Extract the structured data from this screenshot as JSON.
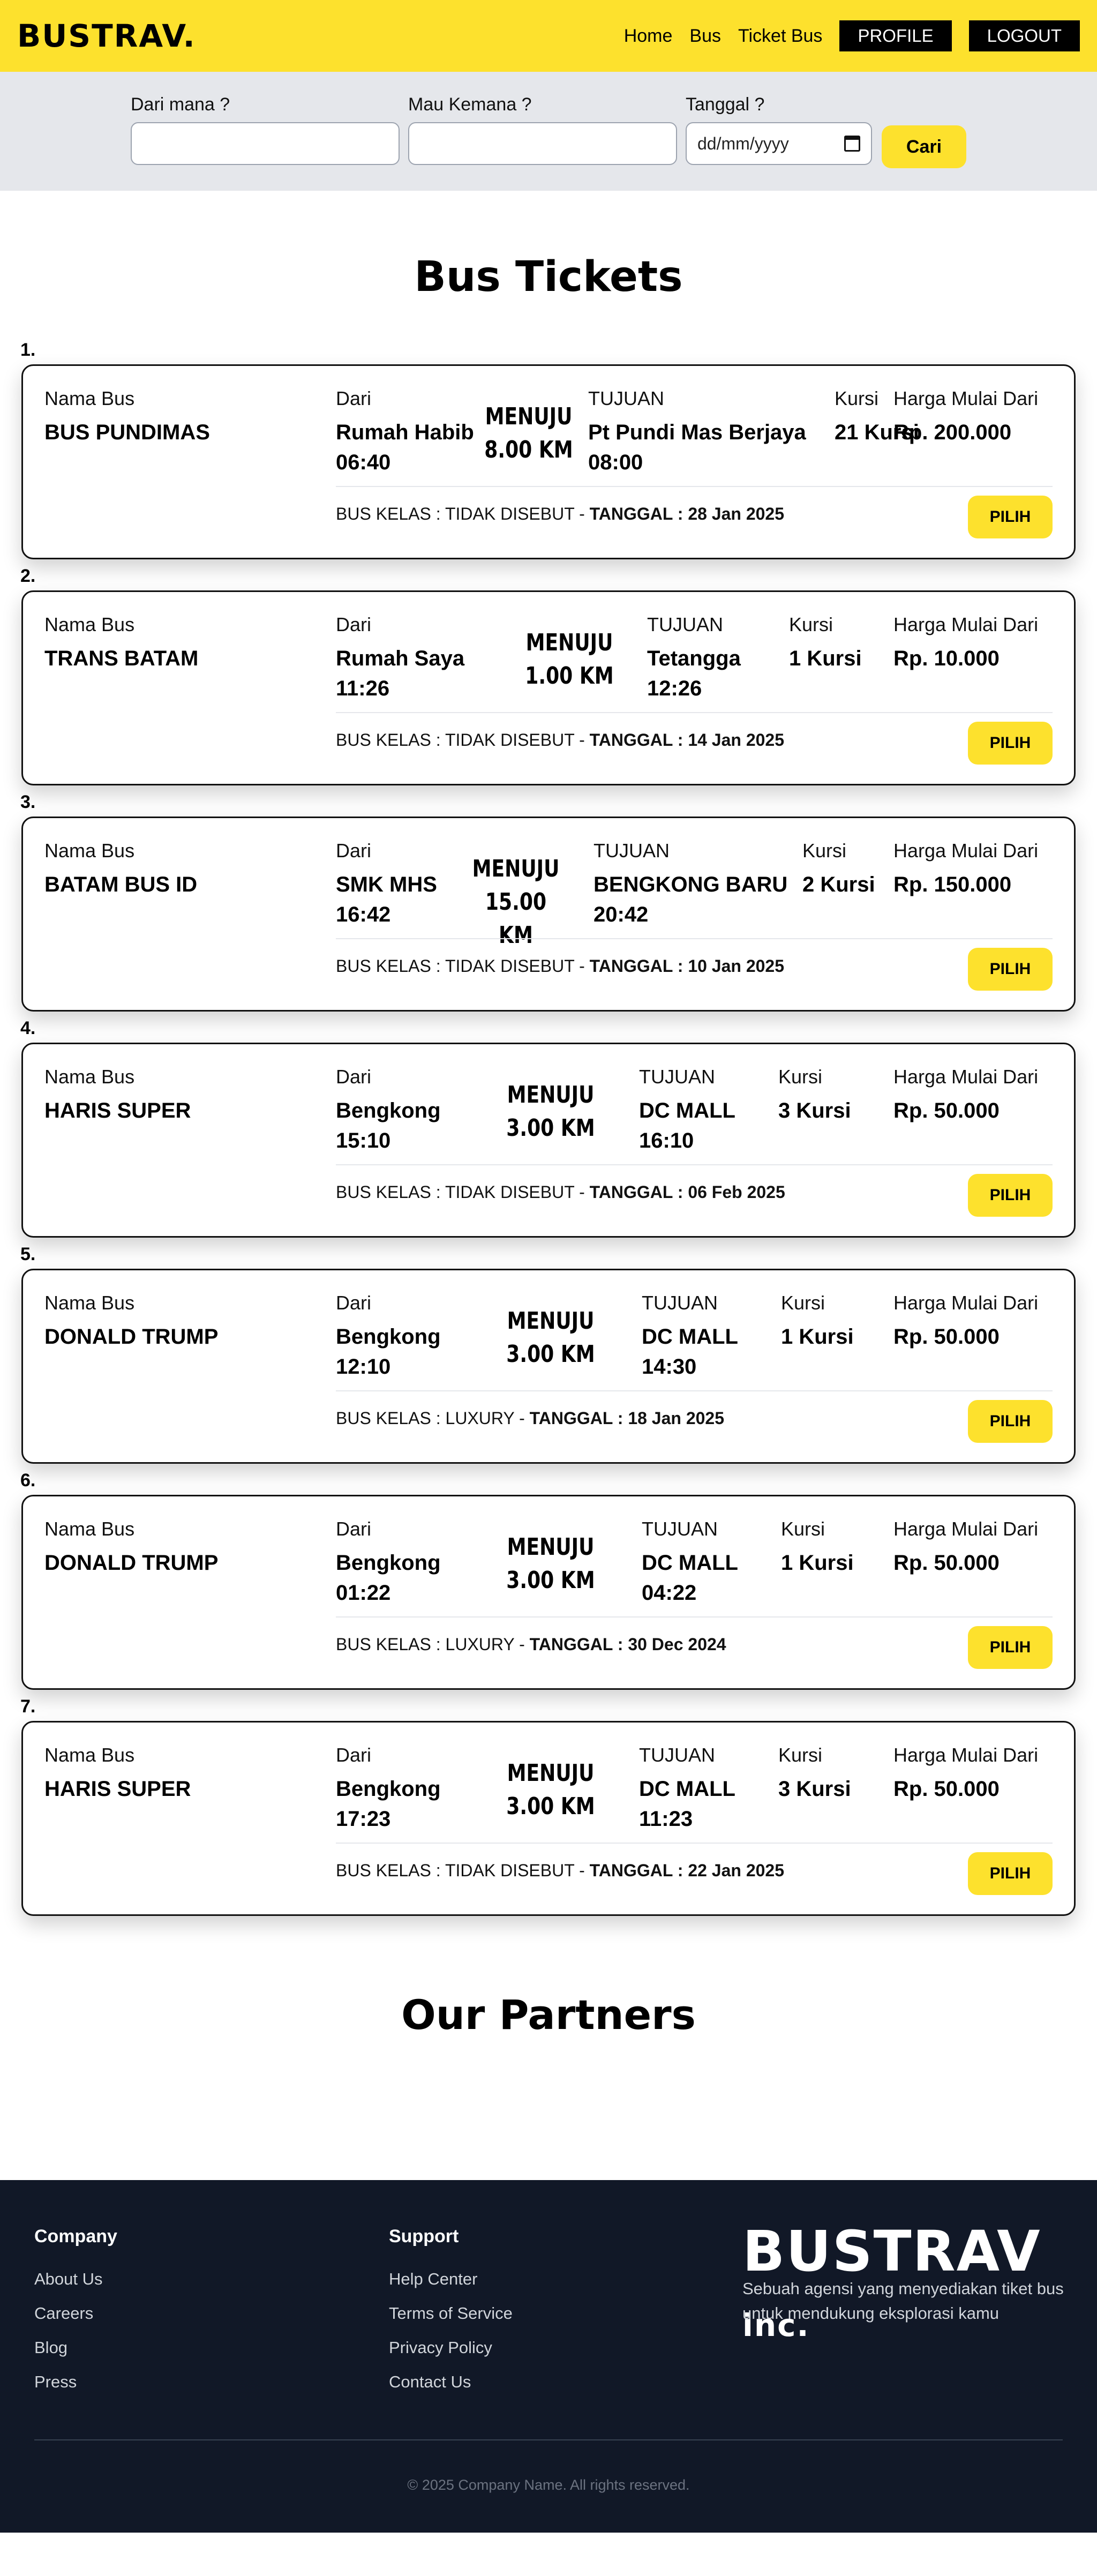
{
  "navbar": {
    "brand": "BUSTRAV.",
    "links": [
      "Home",
      "Bus",
      "Ticket Bus"
    ],
    "profile_label": "PROFILE",
    "logout_label": "LOGOUT",
    "bg_color": "#fde12d"
  },
  "search": {
    "from_label": "Dari mana ?",
    "from_value": "",
    "to_label": "Mau Kemana ?",
    "to_value": "",
    "date_label": "Tanggal ?",
    "date_placeholder": "dd/mm/yyyy",
    "submit_label": "Cari"
  },
  "main": {
    "title": "Bus Tickets"
  },
  "ticket_labels": {
    "bus_name": "Nama Bus",
    "from": "Dari",
    "to": "TUJUAN",
    "seats": "Kursi",
    "price": "Harga Mulai Dari",
    "menuju": "MENUJU",
    "class_prefix": "BUS KELAS :",
    "date_prefix": "TANGGAL :",
    "select": "PILIH"
  },
  "tickets": [
    {
      "num": "1.",
      "bus": "BUS PUNDIMAS",
      "from": "Rumah Habib",
      "depart": "06:40",
      "distance": "8.00 KM",
      "to": "Pt Pundi Mas Berjaya",
      "arrive": "08:00",
      "seats": "21 Kursi",
      "price": "Rp. 200.000",
      "bus_class": "TIDAK DISEBUT",
      "date": "28 Jan 2025"
    },
    {
      "num": "2.",
      "bus": "TRANS BATAM",
      "from": "Rumah Saya",
      "depart": "11:26",
      "distance": "1.00 KM",
      "to": "Tetangga",
      "arrive": "12:26",
      "seats": "1 Kursi",
      "price": "Rp. 10.000",
      "bus_class": "TIDAK DISEBUT",
      "date": "14 Jan 2025"
    },
    {
      "num": "3.",
      "bus": "BATAM BUS ID",
      "from": "SMK MHS",
      "depart": "16:42",
      "distance": "15.00 KM",
      "to": "BENGKONG BARU",
      "arrive": "20:42",
      "seats": "2 Kursi",
      "price": "Rp. 150.000",
      "bus_class": "TIDAK DISEBUT",
      "date": "10 Jan 2025"
    },
    {
      "num": "4.",
      "bus": "HARIS SUPER",
      "from": "Bengkong",
      "depart": "15:10",
      "distance": "3.00 KM",
      "to": "DC MALL",
      "arrive": "16:10",
      "seats": "3 Kursi",
      "price": "Rp. 50.000",
      "bus_class": "TIDAK DISEBUT",
      "date": "06 Feb 2025"
    },
    {
      "num": "5.",
      "bus": "DONALD TRUMP",
      "from": "Bengkong",
      "depart": "12:10",
      "distance": "3.00 KM",
      "to": "DC MALL",
      "arrive": "14:30",
      "seats": "1 Kursi",
      "price": "Rp. 50.000",
      "bus_class": "LUXURY",
      "date": "18 Jan 2025"
    },
    {
      "num": "6.",
      "bus": "DONALD TRUMP",
      "from": "Bengkong",
      "depart": "01:22",
      "distance": "3.00 KM",
      "to": "DC MALL",
      "arrive": "04:22",
      "seats": "1 Kursi",
      "price": "Rp. 50.000",
      "bus_class": "LUXURY",
      "date": "30 Dec 2024"
    },
    {
      "num": "7.",
      "bus": "HARIS SUPER",
      "from": "Bengkong",
      "depart": "17:23",
      "distance": "3.00 KM",
      "to": "DC MALL",
      "arrive": "11:23",
      "seats": "3 Kursi",
      "price": "Rp. 50.000",
      "bus_class": "TIDAK DISEBUT",
      "date": "22 Jan 2025"
    }
  ],
  "partners": {
    "title": "Our Partners"
  },
  "footer": {
    "company_heading": "Company",
    "company_links": [
      "About Us",
      "Careers",
      "Blog",
      "Press"
    ],
    "support_heading": "Support",
    "support_links": [
      "Help Center",
      "Terms of Service",
      "Privacy Policy",
      "Contact Us"
    ],
    "logo_main": "BUSTRAV",
    "logo_suffix": "inc.",
    "tagline": "Sebuah agensi yang menyediakan tiket bus untuk mendukung eksplorasi kamu",
    "copyright": "© 2025 Company Name. All rights reserved."
  }
}
